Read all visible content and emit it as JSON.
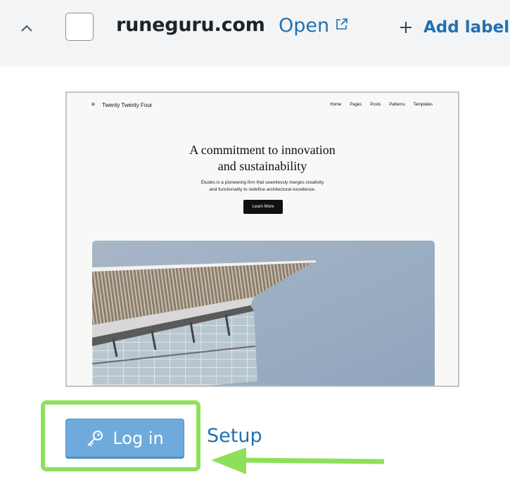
{
  "header": {
    "site_name": "runeguru.com",
    "open_label": "Open",
    "add_label": "Add label"
  },
  "preview": {
    "brand": "Twenty Twenty Four",
    "nav": [
      "Home",
      "Pages",
      "Posts",
      "Patterns",
      "Templates"
    ],
    "headline_line1": "A commitment to innovation",
    "headline_line2": "and sustainability",
    "sub_line1": "Études is a pioneering firm that seamlessly merges creativity",
    "sub_line2": "and functionality to redefine architectural excellence.",
    "cta": "Learn More"
  },
  "actions": {
    "login_label": "Log in",
    "setup_label": "Setup"
  },
  "colors": {
    "link": "#2271b1",
    "login_button": "#6eaadc",
    "highlight": "#8ee05a",
    "header_bg": "#f3f4f5"
  },
  "icons": {
    "collapse": "chevron-up-icon",
    "external": "external-link-icon",
    "add": "plus-icon",
    "login": "key-icon",
    "annotation": "arrow-left-icon"
  }
}
